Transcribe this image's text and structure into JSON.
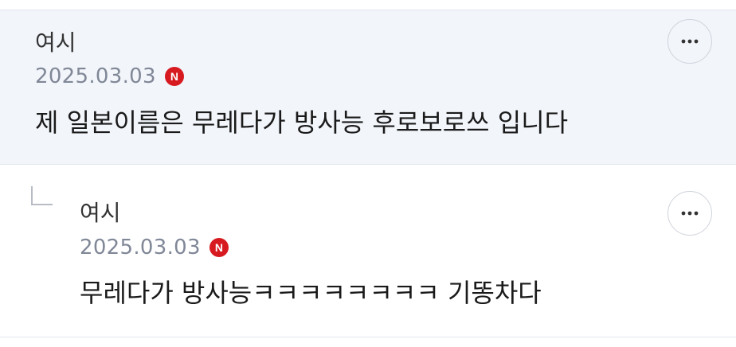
{
  "comments": [
    {
      "author": "여시",
      "date": "2025.03.03",
      "badge": "N",
      "text": "제 일본이름은 무레다가 방사능 후로보로쓰 입니다",
      "more_icon": "ellipsis-horizontal-icon"
    },
    {
      "author": "여시",
      "date": "2025.03.03",
      "badge": "N",
      "text": "무레다가 방사능ㅋㅋㅋㅋㅋㅋㅋㅋ 기똥차다",
      "more_icon": "ellipsis-horizontal-icon",
      "reply_icon": "reply-arrow-icon"
    }
  ],
  "colors": {
    "highlight_bg": "#f2f5fa",
    "badge_red": "#d71920",
    "date_gray": "#808797",
    "divider": "#e3e6ec"
  }
}
